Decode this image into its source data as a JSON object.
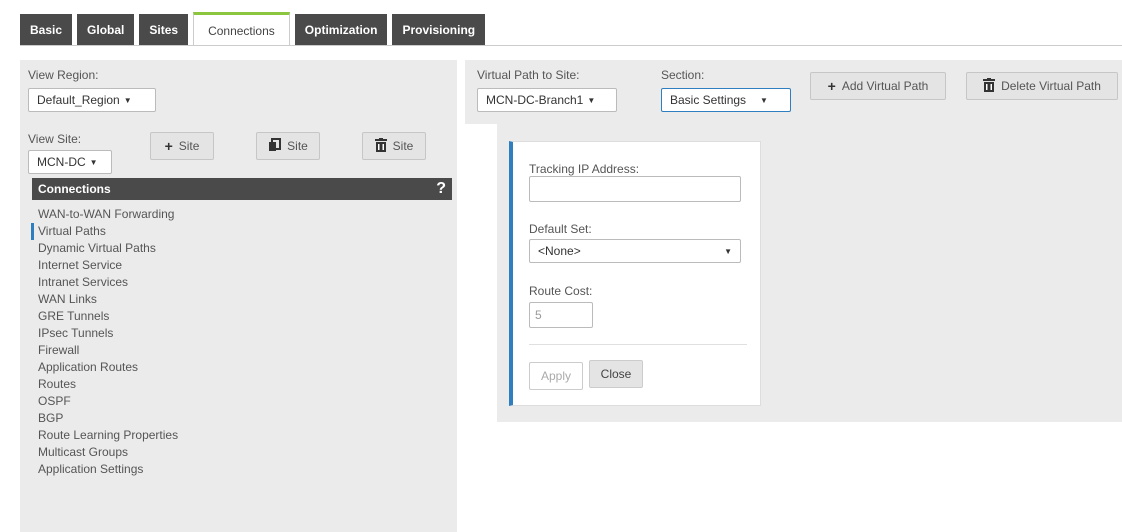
{
  "tabs": [
    {
      "label": "Basic",
      "active": false
    },
    {
      "label": "Global",
      "active": false
    },
    {
      "label": "Sites",
      "active": false
    },
    {
      "label": "Connections",
      "active": true
    },
    {
      "label": "Optimization",
      "active": false
    },
    {
      "label": "Provisioning",
      "active": false
    }
  ],
  "left": {
    "view_region_label": "View Region:",
    "view_region_value": "Default_Region",
    "view_site_label": "View Site:",
    "view_site_value": "MCN-DC",
    "add_site": "Site",
    "clone_site": "Site",
    "delete_site": "Site",
    "connections_header": "Connections",
    "help": "?",
    "menu": [
      "WAN-to-WAN Forwarding",
      "Virtual Paths",
      "Dynamic Virtual Paths",
      "Internet Service",
      "Intranet Services",
      "WAN Links",
      "GRE Tunnels",
      "IPsec Tunnels",
      "Firewall",
      "Application Routes",
      "Routes",
      "OSPF",
      "BGP",
      "Route Learning Properties",
      "Multicast Groups",
      "Application Settings"
    ],
    "active_menu_index": 1
  },
  "right": {
    "vpath_label": "Virtual Path to Site:",
    "vpath_value": "MCN-DC-Branch1",
    "section_label": "Section:",
    "section_value": "Basic Settings",
    "add_vpath": "Add Virtual Path",
    "delete_vpath": "Delete Virtual Path"
  },
  "form": {
    "tracking_ip_label": "Tracking IP Address:",
    "tracking_ip_value": "",
    "default_set_label": "Default Set:",
    "default_set_value": "<None>",
    "route_cost_label": "Route Cost:",
    "route_cost_value": "5",
    "apply": "Apply",
    "close": "Close"
  },
  "colors": {
    "tab_dark": "#4a4a4a",
    "tab_active_accent": "#8cc63f",
    "panel_bg": "#ebebeb",
    "selection_accent": "#2f7ec0"
  },
  "icons": {
    "dropdown": "chevron-down-icon",
    "add": "plus-icon",
    "clone": "copy-icon",
    "delete": "trash-icon",
    "help": "help-icon"
  }
}
